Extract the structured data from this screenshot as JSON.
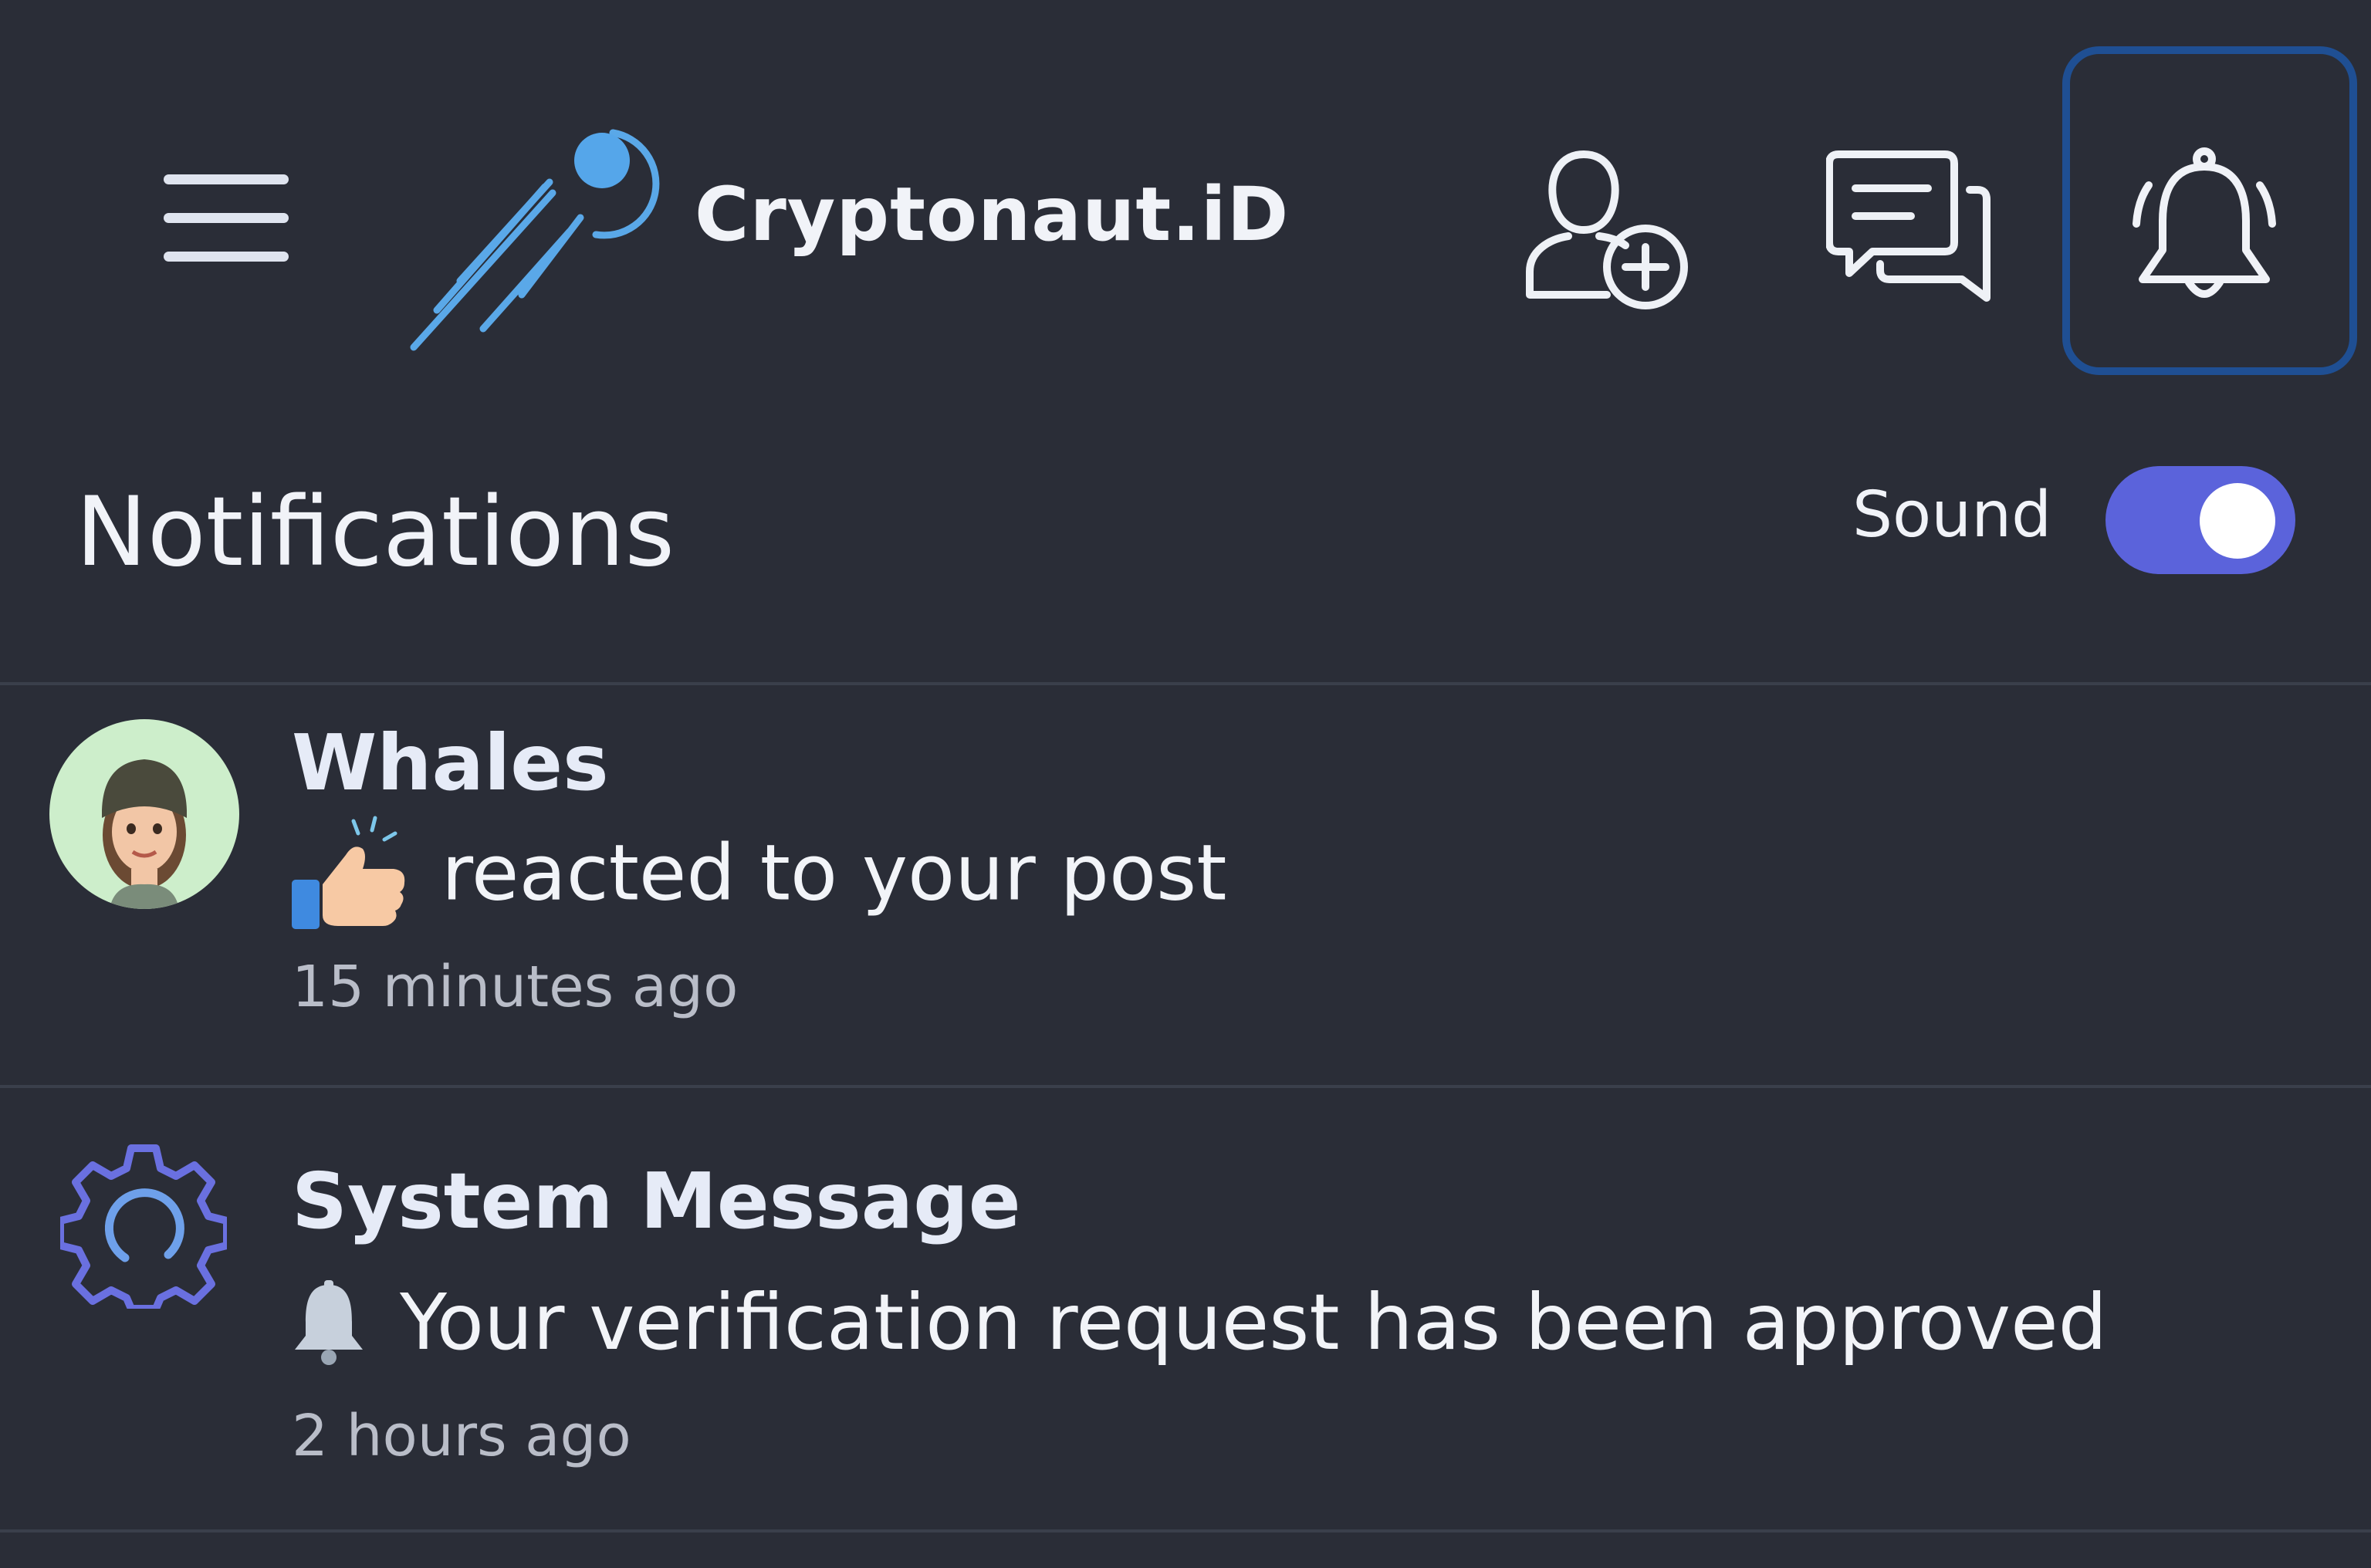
{
  "header": {
    "brand": "Cryptonaut.iD",
    "menu_icon": "hamburger-menu-icon",
    "logo_icon": "comet-logo-icon",
    "actions": [
      "add-user-icon",
      "messages-icon",
      "bell-icon"
    ],
    "accent_color": "#1f4f93"
  },
  "notifications_header": {
    "title": "Notifications",
    "sound_label": "Sound",
    "sound_enabled": true,
    "toggle_color": "#5b63db"
  },
  "notifications": [
    {
      "title": "Whales",
      "body": "reacted to your post",
      "time": "15 minutes ago",
      "icon": "thumbs-up-emoji-icon",
      "avatar": "user-avatar"
    },
    {
      "title": "System Message",
      "body": "Your verification request has been approved",
      "time": "2 hours ago",
      "icon": "bell-emoji-icon",
      "avatar": "gear-icon"
    }
  ]
}
